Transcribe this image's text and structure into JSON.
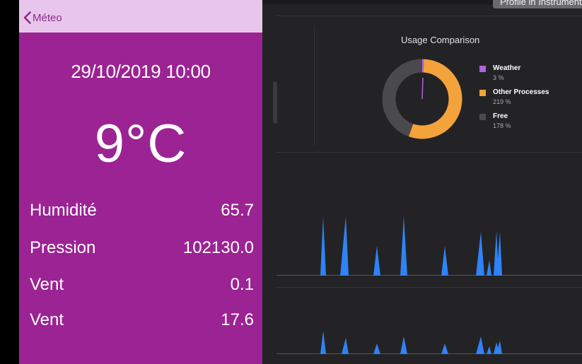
{
  "simulator": {
    "back_label": "Méteo",
    "datetime": "29/10/2019 10:00",
    "temperature": "9°C",
    "rows": [
      {
        "label": "Humidité",
        "value": "65.7"
      },
      {
        "label": "Pression",
        "value": "102130.0"
      },
      {
        "label": "Vent",
        "value": "0.1"
      },
      {
        "label": "Vent",
        "value": "17.6"
      }
    ],
    "colors": {
      "background": "#9c2393",
      "navbar": "#e8c6ec",
      "back_tint": "#8a2a8a"
    }
  },
  "instruments": {
    "profile_button_label": "Profile in Instruments",
    "usage_comparison": {
      "title": "Usage Comparison",
      "legend": [
        {
          "name": "Weather",
          "value": "3 %",
          "color": "#b063e0",
          "percent": 3
        },
        {
          "name": "Other Processes",
          "value": "219 %",
          "color": "#f3a33a",
          "percent": 219
        },
        {
          "name": "Free",
          "value": "178 %",
          "color": "#4a4a4c",
          "percent": 178
        }
      ]
    },
    "graph_color": "#2f83f7"
  }
}
